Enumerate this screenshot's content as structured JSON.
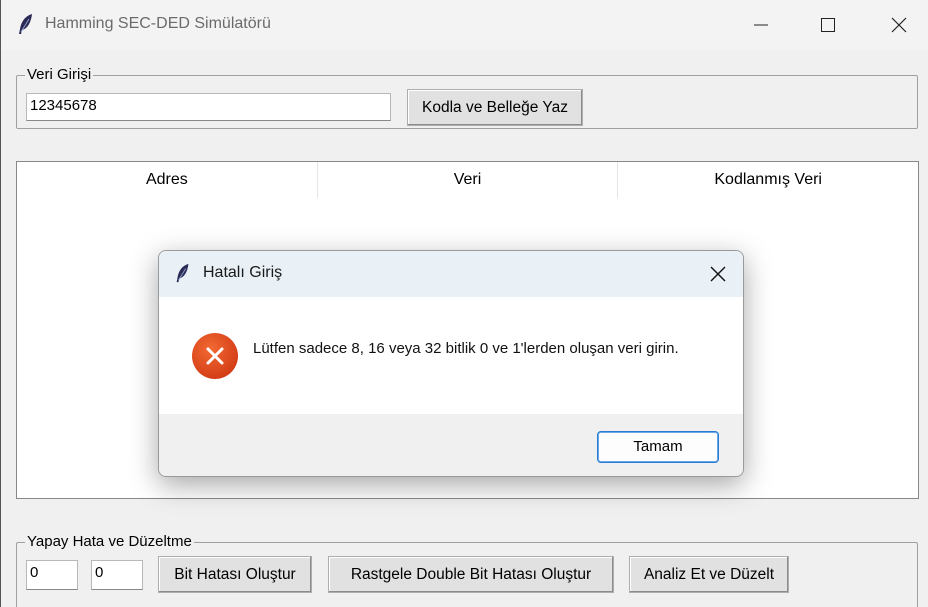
{
  "window": {
    "title": "Hamming SEC-DED Simülatörü",
    "icon": "feather-icon"
  },
  "input_group": {
    "label": "Veri Girişi",
    "input_value": "12345678",
    "encode_button": "Kodla ve Belleğe Yaz"
  },
  "table": {
    "columns": [
      "Adres",
      "Veri",
      "Kodlanmış Veri"
    ],
    "rows": []
  },
  "error_group": {
    "label": "Yapay Hata ve Düzeltme",
    "field1_value": "0",
    "field2_value": "0",
    "bit_error_button": "Bit Hatası Oluştur",
    "double_bit_button": "Rastgele Double Bit Hatası Oluştur",
    "analyze_button": "Analiz Et ve Düzelt"
  },
  "dialog": {
    "title": "Hatalı Giriş",
    "message": "Lütfen sadece 8, 16 veya 32 bitlik 0 ve 1'lerden oluşan veri girin.",
    "ok_button": "Tamam",
    "icon": "error-icon",
    "icon_color": "#e0441b"
  }
}
